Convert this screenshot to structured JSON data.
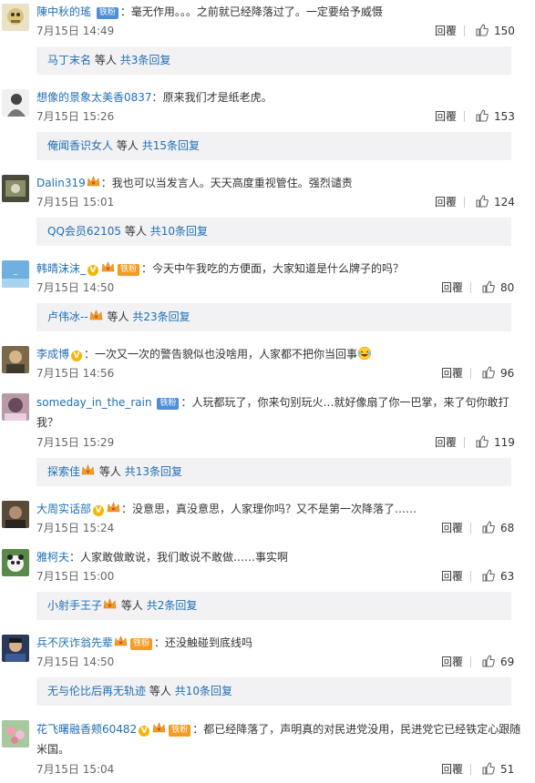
{
  "comments": [
    {
      "user": "陳中秋的瑤",
      "badge": "铁粉",
      "vip": false,
      "crown": false,
      "text": "毫无作用。。。之前就已经降落过了。一定要给予威慑",
      "time": "7月15日 14:49",
      "reply": "回覆",
      "likes": "150",
      "replies_user": "马丁末名",
      "replies_mid": "等人",
      "replies_count": "共3条回复"
    },
    {
      "user": "想像的景象太美香0837",
      "badge": "",
      "vip": false,
      "crown": false,
      "text": "原来我们才是纸老虎。",
      "time": "7月15日 15:26",
      "reply": "回覆",
      "likes": "153",
      "replies_user": "俺闻香识女人",
      "replies_mid": "等人",
      "replies_count": "共15条回复"
    },
    {
      "user": "Dalin319",
      "badge": "",
      "vip": false,
      "crown": true,
      "text": "我也可以当发言人。天天高度重视管住。强烈谴责",
      "time": "7月15日 15:01",
      "reply": "回覆",
      "likes": "124",
      "replies_user": "QQ会员62105",
      "replies_mid": "等人",
      "replies_count": "共10条回复"
    },
    {
      "user": "韩晴沫沫_",
      "badge": "铁粉",
      "vip": true,
      "crown": true,
      "text": "今天中午我吃的方便面，大家知道是什么牌子的吗？",
      "time": "7月15日 14:50",
      "reply": "回覆",
      "likes": "80",
      "replies_user": "卢伟冰--",
      "replies_mid": "等人",
      "replies_count": "共23条回复"
    },
    {
      "user": "李成博",
      "badge": "",
      "vip": true,
      "crown": false,
      "text": "一次又一次的警告貌似也没啥用，人家都不把你当回事",
      "time": "7月15日 14:56",
      "reply": "回覆",
      "likes": "96",
      "replies_user": "",
      "replies_mid": "",
      "replies_count": ""
    },
    {
      "user": "someday_in_the_rain",
      "badge": "铁粉",
      "vip": false,
      "crown": false,
      "text": "人玩都玩了，你来句别玩火…就好像扇了你一巴掌，来了句你敢打我？",
      "time": "7月15日 15:29",
      "reply": "回覆",
      "likes": "119",
      "replies_user": "探索佳",
      "replies_mid": "等人",
      "replies_count": "共13条回复"
    },
    {
      "user": "大周实话部",
      "badge": "",
      "vip": true,
      "crown": true,
      "text": "没意思，真没意思，人家理你吗？又不是第一次降落了……",
      "time": "7月15日 15:24",
      "reply": "回覆",
      "likes": "68",
      "replies_user": "",
      "replies_mid": "",
      "replies_count": ""
    },
    {
      "user": "雅柯夫",
      "badge": "",
      "vip": false,
      "crown": false,
      "text": "人家敢做敢说，我们敢说不敢做……事实啊",
      "time": "7月15日 15:00",
      "reply": "回覆",
      "likes": "63",
      "replies_user": "小射手王子",
      "replies_mid": "等人",
      "replies_count": "共2条回复"
    },
    {
      "user": "兵不厌诈翁先辈",
      "badge": "铁粉",
      "vip": false,
      "crown": true,
      "text": "还没触碰到底线吗",
      "time": "7月15日 14:50",
      "reply": "回覆",
      "likes": "69",
      "replies_user": "无与伦比后再无轨迹",
      "replies_mid": "等人",
      "replies_count": "共10条回复"
    },
    {
      "user": "花飞曙融香颊60482",
      "badge": "铁粉",
      "vip": true,
      "crown": true,
      "text": "都已经降落了，声明真的对民进党没用，民进党它已经铁定心跟随米国。",
      "time": "7月15日 15:04",
      "reply": "回覆",
      "likes": "51",
      "replies_user": "",
      "replies_mid": "",
      "replies_count": ""
    }
  ],
  "colors": {
    "username": "#eb7350",
    "link": "#1f6fb5",
    "subbox_bg": "#f2f2f5",
    "badge": "#4f8fd8",
    "vip": "#f7b500"
  },
  "icons": {
    "like": "thumbs-up-icon",
    "vip": "v-verified-icon",
    "crown": "crown-icon",
    "emoji": "laugh-cry-emoji-icon"
  }
}
